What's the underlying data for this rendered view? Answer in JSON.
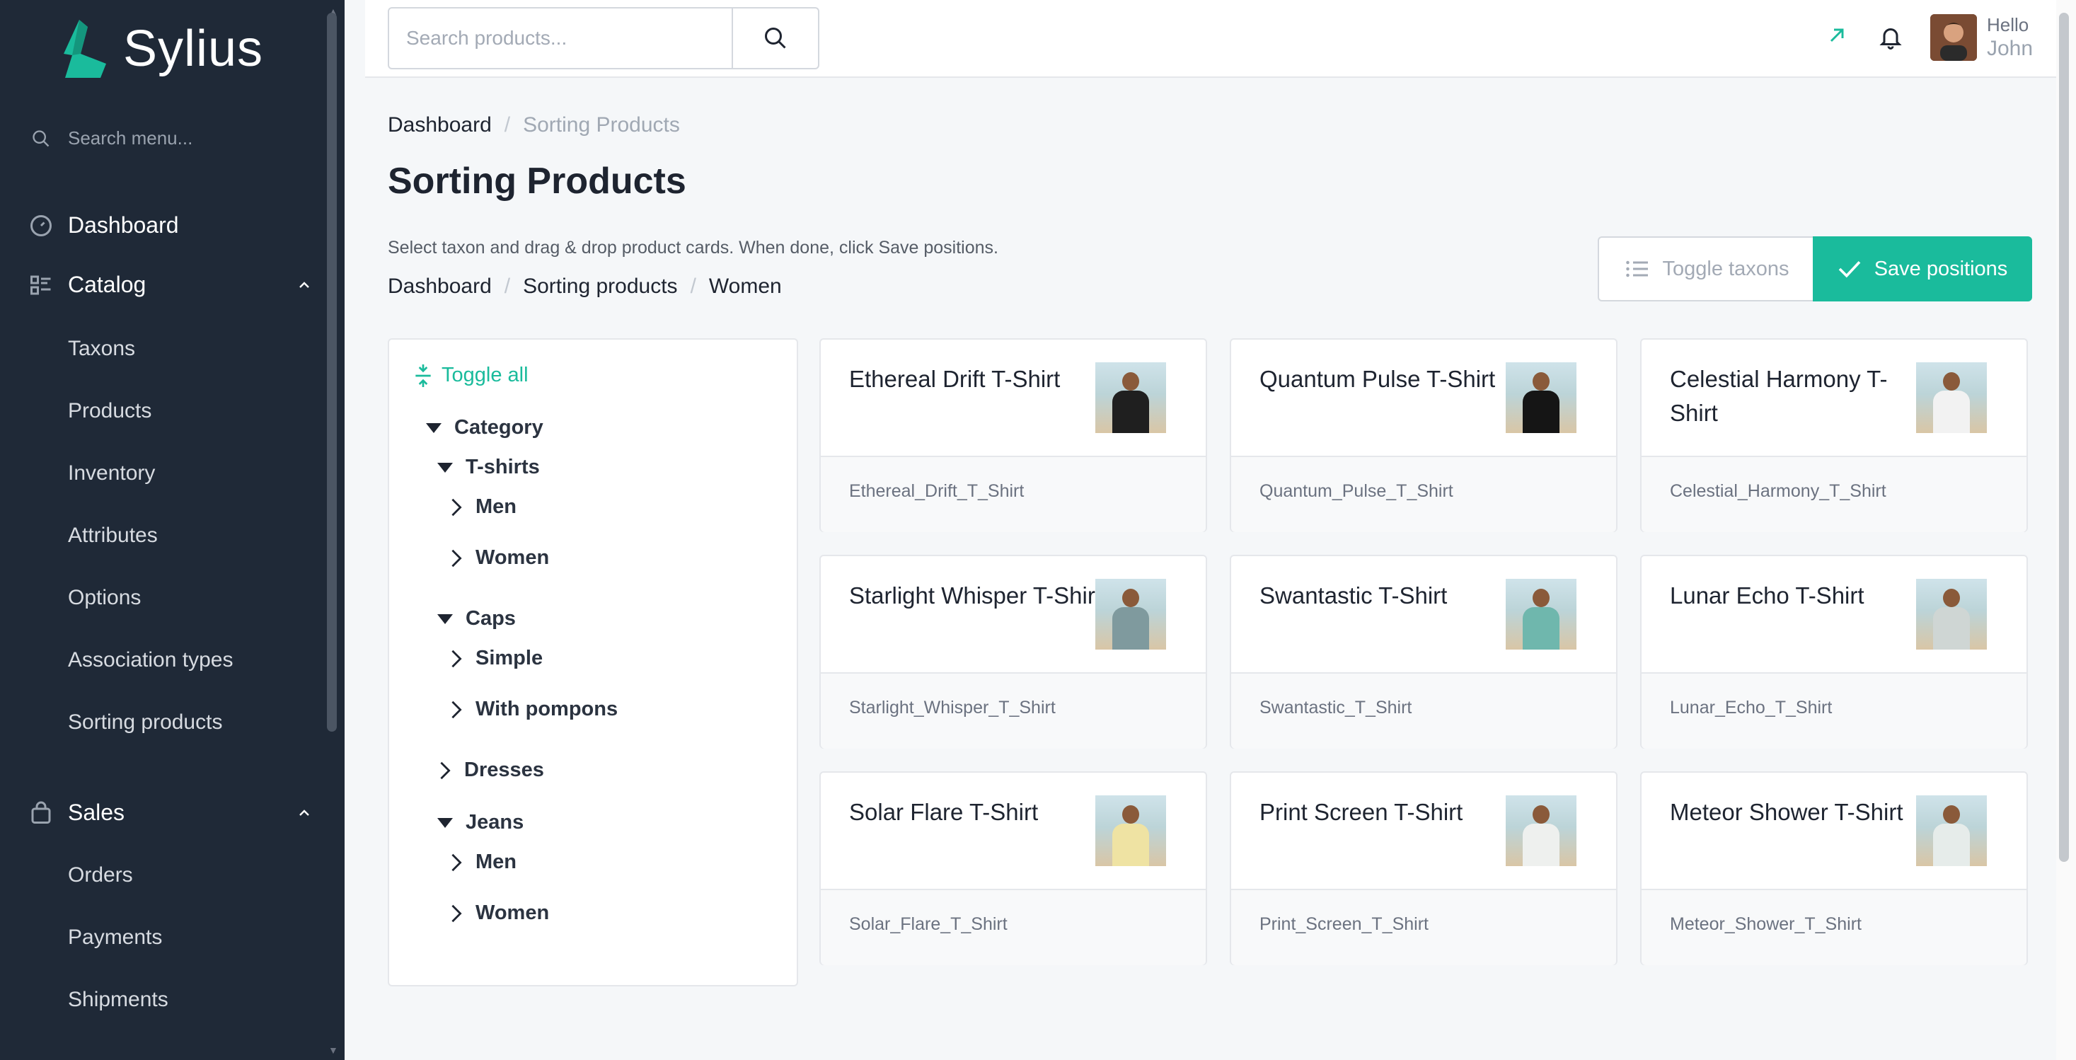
{
  "sidebar": {
    "logo_text": "Sylius",
    "search_placeholder": "Search menu...",
    "dashboard": "Dashboard",
    "catalog": {
      "label": "Catalog",
      "items": [
        "Taxons",
        "Products",
        "Inventory",
        "Attributes",
        "Options",
        "Association types",
        "Sorting products"
      ]
    },
    "sales": {
      "label": "Sales",
      "items": [
        "Orders",
        "Payments",
        "Shipments"
      ]
    }
  },
  "topbar": {
    "search_placeholder": "Search products...",
    "hello": "Hello",
    "user_name": "John"
  },
  "breadcrumb": [
    "Dashboard",
    "Sorting Products"
  ],
  "page_title": "Sorting Products",
  "subtitle": "Select taxon and drag & drop product cards. When done, click Save positions.",
  "breadcrumb2": [
    "Dashboard",
    "Sorting products",
    "Women"
  ],
  "actions": {
    "toggle_taxons": "Toggle taxons",
    "save_positions": "Save positions",
    "accent_color": "#1abb9c"
  },
  "tree": {
    "toggle_all": "Toggle all",
    "nodes": {
      "category": "Category",
      "tshirts": "T-shirts",
      "tshirts_men": "Men",
      "tshirts_women": "Women",
      "caps": "Caps",
      "caps_simple": "Simple",
      "caps_pompons": "With pompons",
      "dresses": "Dresses",
      "jeans": "Jeans",
      "jeans_men": "Men",
      "jeans_women": "Women"
    }
  },
  "products": [
    {
      "name": "Ethereal Drift T-Shirt",
      "code": "Ethereal_Drift_T_Shirt",
      "shirt_color": "#1f1f1f"
    },
    {
      "name": "Quantum Pulse T-Shirt",
      "code": "Quantum_Pulse_T_Shirt",
      "shirt_color": "#151515"
    },
    {
      "name": "Celestial Harmony T-Shirt",
      "code": "Celestial_Harmony_T_Shirt",
      "shirt_color": "#f2f2f2"
    },
    {
      "name": "Starlight Whisper T-Shirt",
      "code": "Starlight_Whisper_T_Shirt",
      "shirt_color": "#7f9a9e"
    },
    {
      "name": "Swantastic T-Shirt",
      "code": "Swantastic_T_Shirt",
      "shirt_color": "#6fb7ad"
    },
    {
      "name": "Lunar Echo T-Shirt",
      "code": "Lunar_Echo_T_Shirt",
      "shirt_color": "#cfd6d4"
    },
    {
      "name": "Solar Flare T-Shirt",
      "code": "Solar_Flare_T_Shirt",
      "shirt_color": "#efe3a3"
    },
    {
      "name": "Print Screen T-Shirt",
      "code": "Print_Screen_T_Shirt",
      "shirt_color": "#eef0ee"
    },
    {
      "name": "Meteor Shower T-Shirt",
      "code": "Meteor_Shower_T_Shirt",
      "shirt_color": "#e6ecea"
    }
  ]
}
